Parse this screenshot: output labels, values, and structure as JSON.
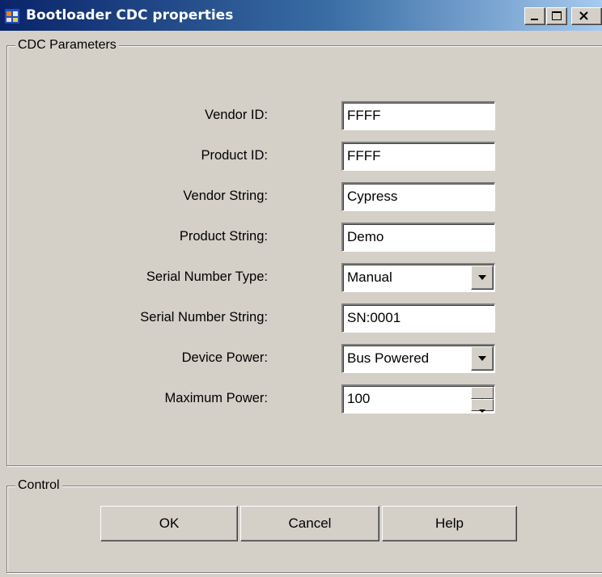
{
  "window": {
    "title": "Bootloader CDC properties"
  },
  "cdc_group": {
    "legend": "CDC Parameters",
    "fields": [
      {
        "label": "Vendor ID:",
        "value": "FFFF",
        "kind": "text"
      },
      {
        "label": "Product ID:",
        "value": "FFFF",
        "kind": "text"
      },
      {
        "label": "Vendor String:",
        "value": "Cypress",
        "kind": "text"
      },
      {
        "label": "Product String:",
        "value": "Demo",
        "kind": "text"
      },
      {
        "label": "Serial Number Type:",
        "value": "Manual",
        "kind": "dropdown"
      },
      {
        "label": "Serial Number String:",
        "value": "SN:0001",
        "kind": "text"
      },
      {
        "label": "Device Power:",
        "value": "Bus Powered",
        "kind": "dropdown"
      },
      {
        "label": "Maximum Power:",
        "value": "100",
        "kind": "spinner"
      }
    ]
  },
  "control_group": {
    "legend": "Control",
    "buttons": {
      "ok": "OK",
      "cancel": "Cancel",
      "help": "Help"
    }
  },
  "icons": {
    "app": "app-window-icon",
    "minimize": "minimize-icon",
    "maximize": "maximize-icon",
    "close": "close-icon",
    "dropdown": "chevron-down-icon",
    "spin_up": "spin-up-icon",
    "spin_down": "spin-down-icon"
  },
  "colors": {
    "titlebar_start": "#0a246a",
    "titlebar_end": "#a6caf0",
    "face": "#d4d0c8"
  }
}
